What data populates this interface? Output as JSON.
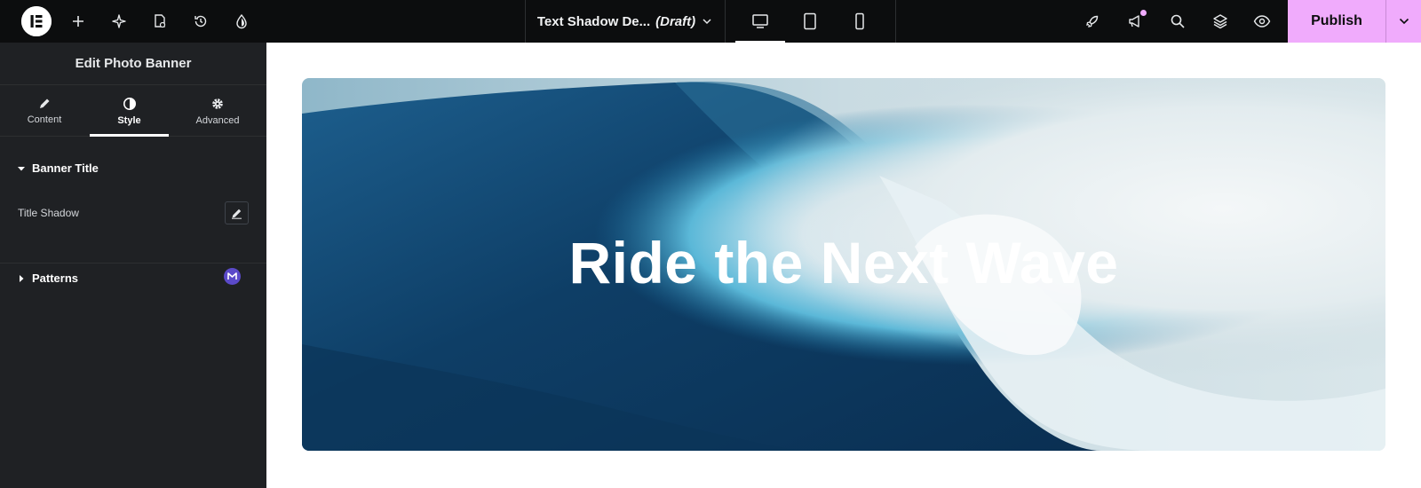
{
  "topbar": {
    "doc_name": "Text Shadow De...",
    "doc_status": "(Draft)",
    "publish_label": "Publish",
    "accent": "#f0abfc"
  },
  "panel": {
    "header_title": "Edit Photo Banner",
    "tabs": [
      {
        "label": "Content",
        "icon": "pencil-icon"
      },
      {
        "label": "Style",
        "icon": "contrast-icon"
      },
      {
        "label": "Advanced",
        "icon": "gear-icon"
      }
    ],
    "active_tab": "Style",
    "sections": {
      "banner_title": "Banner Title",
      "title_shadow_label": "Title Shadow",
      "patterns": "Patterns"
    }
  },
  "canvas": {
    "banner_title": "Ride the Next Wave"
  }
}
